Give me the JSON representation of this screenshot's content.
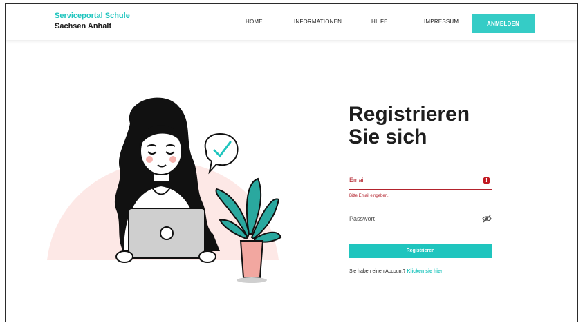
{
  "brand": {
    "line1": "Serviceportal Schule",
    "line2": "Sachsen Anhalt"
  },
  "nav": {
    "items": [
      {
        "label": "HOME"
      },
      {
        "label": "INFORMATIONEN"
      },
      {
        "label": "HILFE"
      },
      {
        "label": "IMPRESSUM"
      }
    ],
    "login_label": "ANMELDEN"
  },
  "form": {
    "title_line1": "Registrieren",
    "title_line2": "Sie sich",
    "email": {
      "placeholder": "Email",
      "value": "",
      "error_icon": "!",
      "error_message": "Bitte Email eingeben."
    },
    "password": {
      "placeholder": "Passwort",
      "value": "",
      "toggle_icon": "eye-slash-icon"
    },
    "submit_label": "Registrieren",
    "account_text": "Sie haben einen Account?",
    "account_link": "Klicken sie hier"
  },
  "colors": {
    "accent": "#1fc5be",
    "login_button": "#35ccc6",
    "error": "#b3232d",
    "blob": "#fde8e6",
    "plant_leaf": "#2aa89f",
    "pot": "#f2a7a0"
  }
}
